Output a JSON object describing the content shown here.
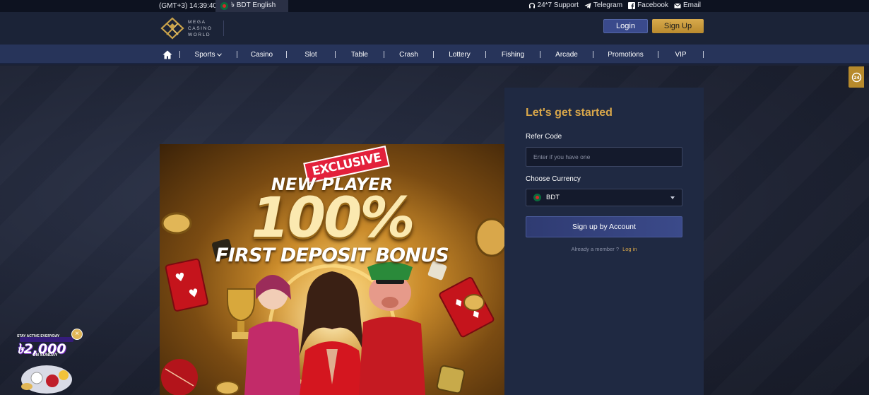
{
  "topbar": {
    "time": "(GMT+3) 14:39:40",
    "currency_language": "৳ BDT English",
    "support": "24*7 Support",
    "telegram": "Telegram",
    "facebook": "Facebook",
    "email": "Email"
  },
  "header": {
    "logo_lines": [
      "MEGA",
      "CASINO",
      "WORLD"
    ],
    "login": "Login",
    "signup": "Sign Up"
  },
  "nav": {
    "items": [
      {
        "label": "Sports",
        "has_dropdown": true
      },
      {
        "label": "Casino"
      },
      {
        "label": "Slot"
      },
      {
        "label": "Table"
      },
      {
        "label": "Crash"
      },
      {
        "label": "Lottery"
      },
      {
        "label": "Fishing"
      },
      {
        "label": "Arcade"
      },
      {
        "label": "Promotions"
      },
      {
        "label": "VIP"
      }
    ]
  },
  "banner": {
    "tag": "EXCLUSIVE",
    "line1": "NEW PLAYER",
    "line2": "100%",
    "line3": "FIRST DEPOSIT BONUS"
  },
  "form": {
    "title": "Let's get started",
    "refer_label": "Refer Code",
    "refer_placeholder": "Enter if you have one",
    "currency_label": "Choose Currency",
    "currency_value": "BDT",
    "submit": "Sign up by Account",
    "already_member": "Already a member ?",
    "login_link": "Log in"
  },
  "float_button": {
    "icon": "headset-24-icon"
  },
  "promo": {
    "top": "STAY ACTIVE EVERYDAY",
    "amount": "৳2,000",
    "sub": "ON SUNDAY",
    "close": "×"
  },
  "colors": {
    "accent_gold": "#d9a74a",
    "nav_bg": "#27345a",
    "login_bg": "#3a4a8c",
    "card_bg": "#1f2942"
  }
}
